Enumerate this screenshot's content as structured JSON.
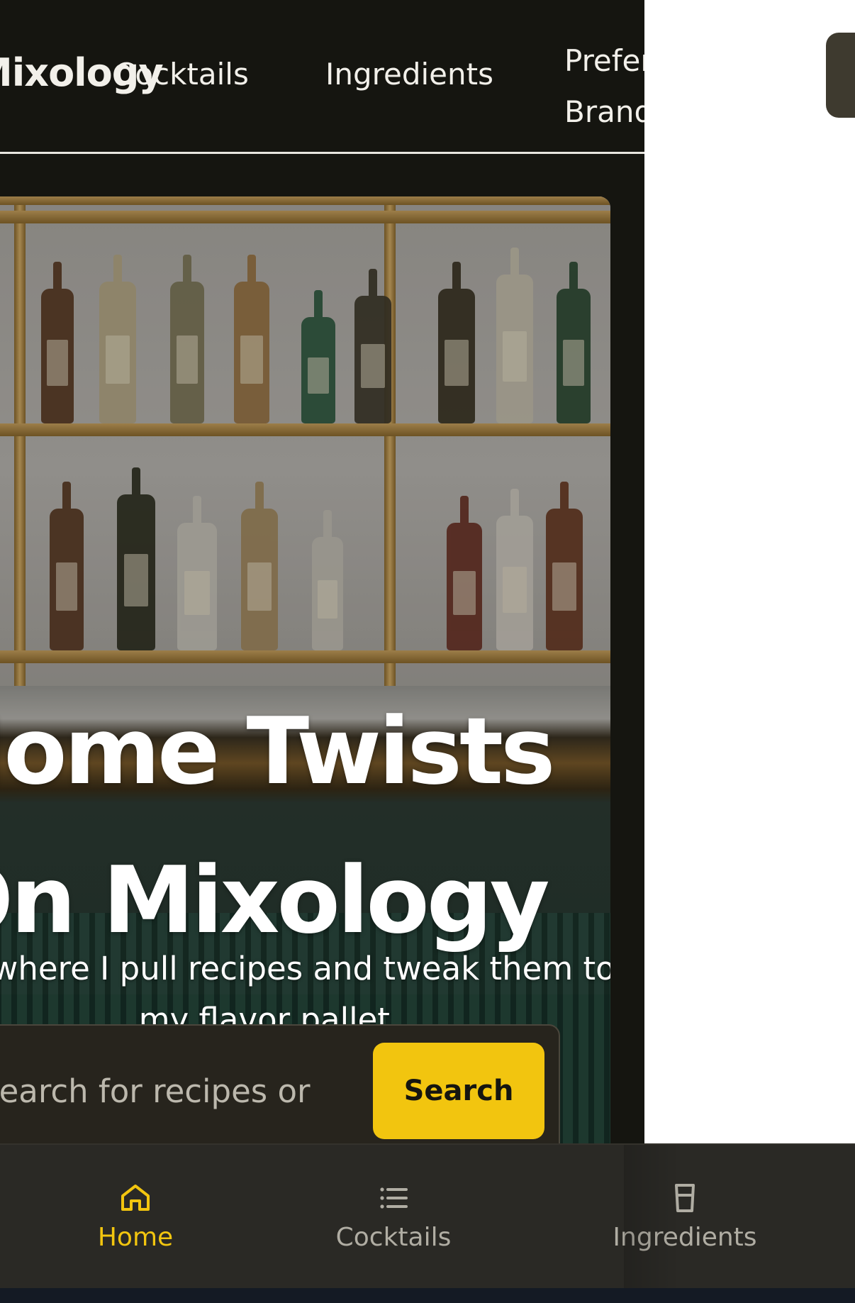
{
  "nav": {
    "brand": "Mixology",
    "links": [
      "Cocktails",
      "Ingredients",
      "Preferred Brands"
    ]
  },
  "hero": {
    "title": "Home Twists On Mixology",
    "subtitle": "This is where I pull recipes and tweak them to fit my flavor pallet."
  },
  "search": {
    "placeholder": "Search for recipes or ingredients",
    "button_label": "Search"
  },
  "tabbar": {
    "items": [
      {
        "label": "Home",
        "icon": "home-icon",
        "active": true
      },
      {
        "label": "Cocktails",
        "icon": "list-icon",
        "active": false
      },
      {
        "label": "Ingredients",
        "icon": "cup-icon",
        "active": false
      }
    ]
  },
  "colors": {
    "accent": "#f2c50f",
    "page_background": "#151510",
    "tabbar_background": "#2a2925",
    "inactive_tab": "#b0ada3"
  }
}
